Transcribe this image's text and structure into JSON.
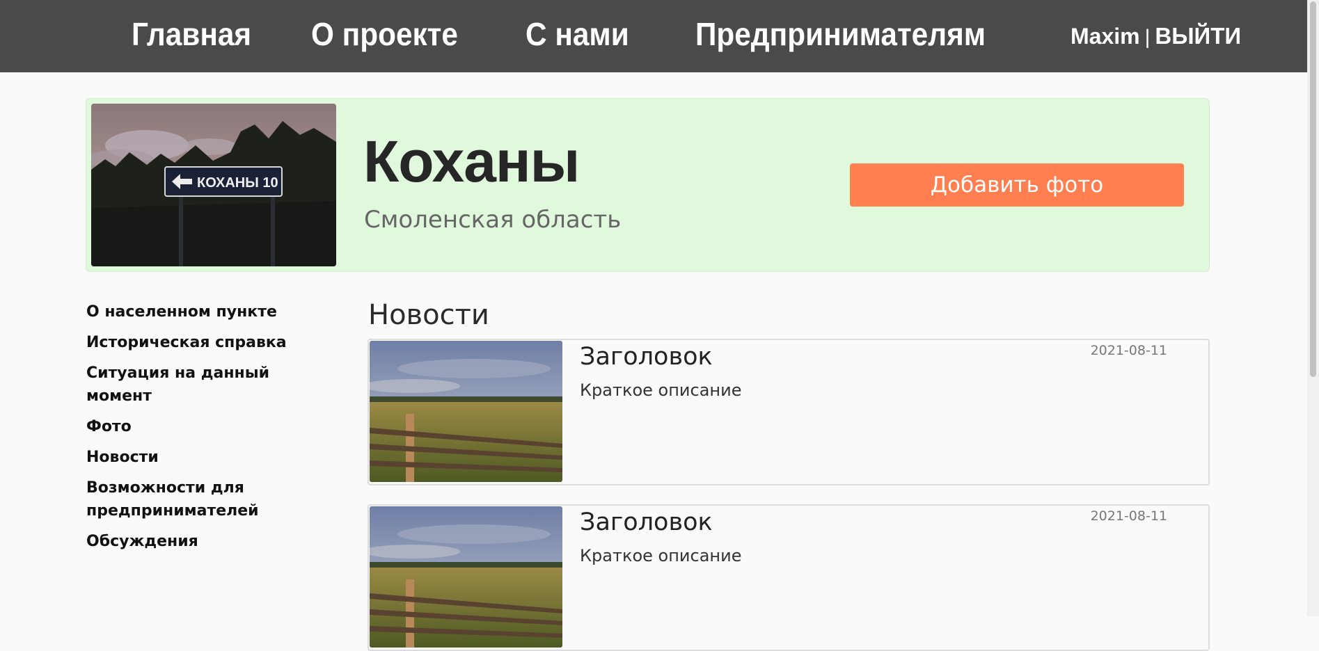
{
  "nav": {
    "home": "Главная",
    "about": "О проекте",
    "with_us": "С нами",
    "entrepreneurs": "Предпринимателям",
    "user": "Maxim",
    "separator": "|",
    "logout": "ВЫЙТИ"
  },
  "hero": {
    "sign_text": "КОХАНЫ 10",
    "title": "Коханы",
    "region": "Смоленская область",
    "add_photo": "Добавить фото"
  },
  "sidebar": {
    "items": [
      {
        "label": "О населенном пункте"
      },
      {
        "label": "Историческая справка"
      },
      {
        "label": "Ситуация на данный момент"
      },
      {
        "label": "Фото"
      },
      {
        "label": "Новости"
      },
      {
        "label": "Возможности для предпринимателей"
      },
      {
        "label": "Обсуждения"
      }
    ]
  },
  "news": {
    "heading": "Новости",
    "items": [
      {
        "title": "Заголовок",
        "description": "Краткое описание",
        "date": "2021-08-11"
      },
      {
        "title": "Заголовок",
        "description": "Краткое описание",
        "date": "2021-08-11"
      }
    ]
  },
  "colors": {
    "navbar": "#4a4a4a",
    "hero_bg": "#e0f8dc",
    "accent_button": "#ff7f50"
  }
}
